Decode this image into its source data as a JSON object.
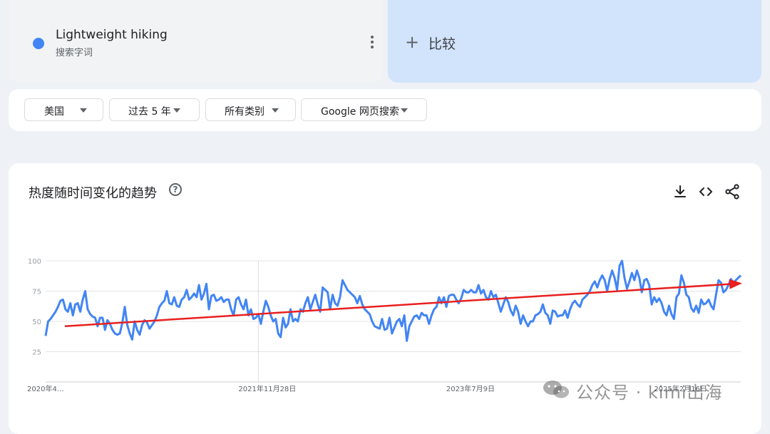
{
  "term": {
    "name": "Lightweight hiking",
    "subtitle": "搜索字词",
    "color": "#4285f4"
  },
  "compare": {
    "label": "比较"
  },
  "filters": [
    {
      "label": "美国"
    },
    {
      "label": "过去 5 年"
    },
    {
      "label": "所有类别"
    },
    {
      "label": "Google 网页搜索"
    }
  ],
  "chart_title": "热度随时间变化的趋势",
  "watermark": "公众号 · kimi出海",
  "chart_data": {
    "type": "line",
    "title": "热度随时间变化的趋势",
    "xlabel": "",
    "ylabel": "",
    "ylim": [
      0,
      100
    ],
    "y_ticks": [
      25,
      50,
      75,
      100
    ],
    "x_tick_labels": [
      "2020年4…",
      "2021年11月28日",
      "2023年7月9日",
      "2025年2月16日"
    ],
    "x_tick_weeks": [
      0,
      86,
      170,
      254
    ],
    "grid": true,
    "series": [
      {
        "color": "#4285f4",
        "values": [
          38,
          50,
          52,
          55,
          58,
          62,
          67,
          68,
          60,
          58,
          65,
          55,
          64,
          65,
          58,
          68,
          75,
          60,
          56,
          54,
          53,
          46,
          53,
          53,
          43,
          51,
          48,
          43,
          40,
          39,
          40,
          49,
          62,
          47,
          40,
          35,
          50,
          43,
          39,
          47,
          51,
          49,
          44,
          47,
          50,
          55,
          62,
          65,
          67,
          75,
          65,
          64,
          70,
          63,
          62,
          68,
          70,
          76,
          68,
          70,
          73,
          70,
          80,
          68,
          73,
          81,
          60,
          71,
          72,
          67,
          68,
          70,
          66,
          68,
          68,
          60,
          55,
          68,
          70,
          64,
          60,
          68,
          55,
          60,
          52,
          53,
          56,
          48,
          58,
          67,
          62,
          55,
          50,
          52,
          40,
          37,
          53,
          45,
          48,
          60,
          50,
          52,
          50,
          60,
          58,
          65,
          70,
          60,
          66,
          72,
          64,
          58,
          78,
          76,
          74,
          60,
          72,
          65,
          63,
          70,
          84,
          80,
          76,
          74,
          72,
          70,
          65,
          71,
          64,
          60,
          58,
          56,
          50,
          46,
          45,
          44,
          52,
          43,
          44,
          53,
          40,
          45,
          50,
          52,
          46,
          55,
          34,
          46,
          50,
          54,
          55,
          52,
          57,
          55,
          55,
          48,
          55,
          60,
          62,
          70,
          65,
          70,
          62,
          71,
          72,
          72,
          68,
          65,
          69,
          76,
          74,
          74,
          76,
          74,
          74,
          80,
          73,
          76,
          70,
          68,
          75,
          70,
          72,
          65,
          58,
          64,
          70,
          66,
          59,
          55,
          63,
          58,
          48,
          55,
          50,
          46,
          50,
          50,
          55,
          56,
          58,
          64,
          57,
          55,
          48,
          59,
          58,
          54,
          55,
          55,
          59,
          53,
          60,
          65,
          67,
          64,
          62,
          68,
          70,
          72,
          75,
          80,
          83,
          78,
          84,
          88,
          84,
          75,
          85,
          92,
          86,
          76,
          96,
          100,
          86,
          77,
          83,
          90,
          84,
          92,
          86,
          74,
          84,
          85,
          80,
          64,
          70,
          66,
          69,
          65,
          58,
          55,
          63,
          56,
          52,
          70,
          73,
          88,
          82,
          72,
          70,
          61,
          58,
          63,
          57,
          68,
          64,
          65,
          68,
          63,
          60,
          72,
          84,
          82,
          74,
          76,
          80,
          85,
          82,
          84,
          86,
          88
        ],
        "trend_line": {
          "color": "#e8201f",
          "start": 46,
          "end": 81
        }
      }
    ]
  }
}
